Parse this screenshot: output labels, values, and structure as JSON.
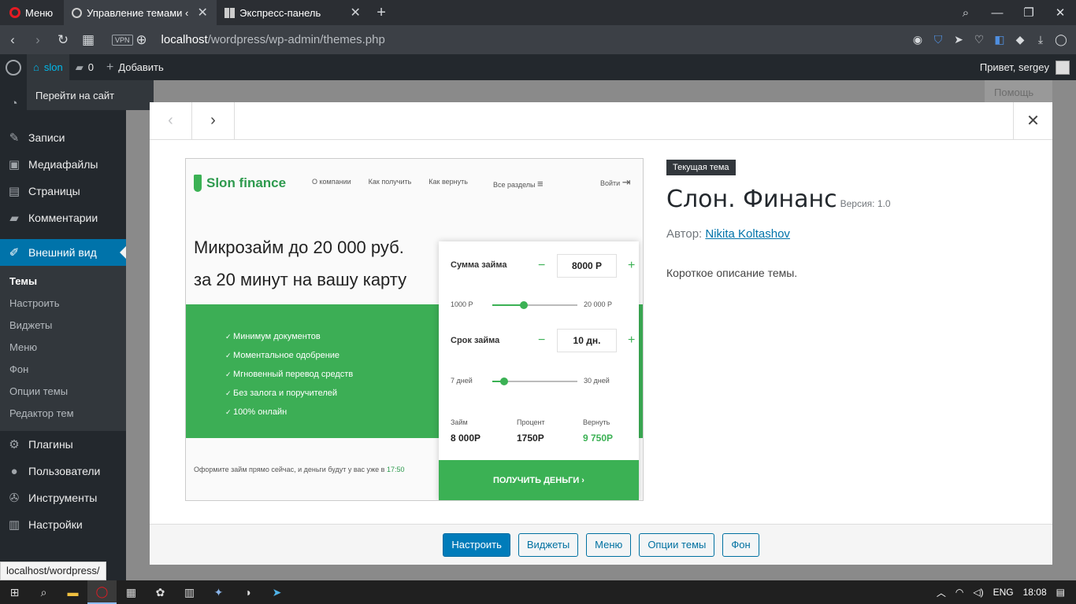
{
  "browser": {
    "menu_label": "Меню",
    "tabs": [
      {
        "title": "Управление темами ‹ slon",
        "active": true
      },
      {
        "title": "Экспресс-панель",
        "active": false
      }
    ],
    "vpn_label": "VPN",
    "url_host": "localhost",
    "url_path": "/wordpress/wp-admin/themes.php"
  },
  "adminbar": {
    "site_name": "slon",
    "comments_count": "0",
    "add_label": "Добавить",
    "greeting": "Привет, sergey",
    "dropdown_label": "Перейти на сайт"
  },
  "sidebar": {
    "items_top": [
      {
        "label": "Записи",
        "icon": "pin-icon"
      },
      {
        "label": "Медиафайлы",
        "icon": "media-icon"
      },
      {
        "label": "Страницы",
        "icon": "pages-icon"
      },
      {
        "label": "Комментарии",
        "icon": "comments-icon"
      }
    ],
    "current": {
      "label": "Внешний вид",
      "icon": "brush-icon"
    },
    "submenu": [
      "Темы",
      "Настроить",
      "Виджеты",
      "Меню",
      "Фон",
      "Опции темы",
      "Редактор тем"
    ],
    "items_bottom": [
      {
        "label": "Плагины",
        "icon": "plugin-icon"
      },
      {
        "label": "Пользователи",
        "icon": "users-icon"
      },
      {
        "label": "Инструменты",
        "icon": "tools-icon"
      },
      {
        "label": "Настройки",
        "icon": "settings-icon"
      }
    ]
  },
  "status_url": "localhost/wordpress/",
  "help_label": "Помощь",
  "theme": {
    "badge": "Текущая тема",
    "name": "Слон. Финанс",
    "version_label": "Версия: 1.0",
    "author_prefix": "Автор:",
    "author_name": "Nikita Koltashov",
    "description": "Короткое описание темы."
  },
  "footer_buttons": [
    "Настроить",
    "Виджеты",
    "Меню",
    "Опции темы",
    "Фон"
  ],
  "preview": {
    "logo": "Slon finance",
    "nav": [
      "О компании",
      "Как получить",
      "Как вернуть"
    ],
    "nav_all": "Все разделы",
    "login": "Войти",
    "headline_1": "Микрозайм до 20 000 руб.",
    "headline_2": "за 20 минут на вашу карту",
    "benefits": [
      "Минимум документов",
      "Моментальное одобрение",
      "Мгновенный перевод средств",
      "Без залога и поручителей",
      "100% онлайн"
    ],
    "bottom_text": "Оформите займ прямо сейчас, и деньги будут у вас уже в",
    "bottom_time": "17:50",
    "sum_label": "Сумма займа",
    "sum_value": "8000 Р",
    "sum_min": "1000 Р",
    "sum_max": "20 000 Р",
    "term_label": "Срок займа",
    "term_value": "10 дн.",
    "term_min": "7 дней",
    "term_max": "30 дней",
    "loan_label": "Займ",
    "loan_value": "8 000Р",
    "percent_label": "Процент",
    "percent_value": "1750Р",
    "return_label": "Вернуть",
    "return_value": "9 750Р",
    "cta": "ПОЛУЧИТЬ ДЕНЬГИ  ›"
  },
  "taskbar": {
    "lang": "ENG",
    "time": "18:08"
  },
  "colors": {
    "wp_blue": "#0073aa",
    "admin_dark": "#23282d",
    "brand_green": "#3bb154"
  }
}
